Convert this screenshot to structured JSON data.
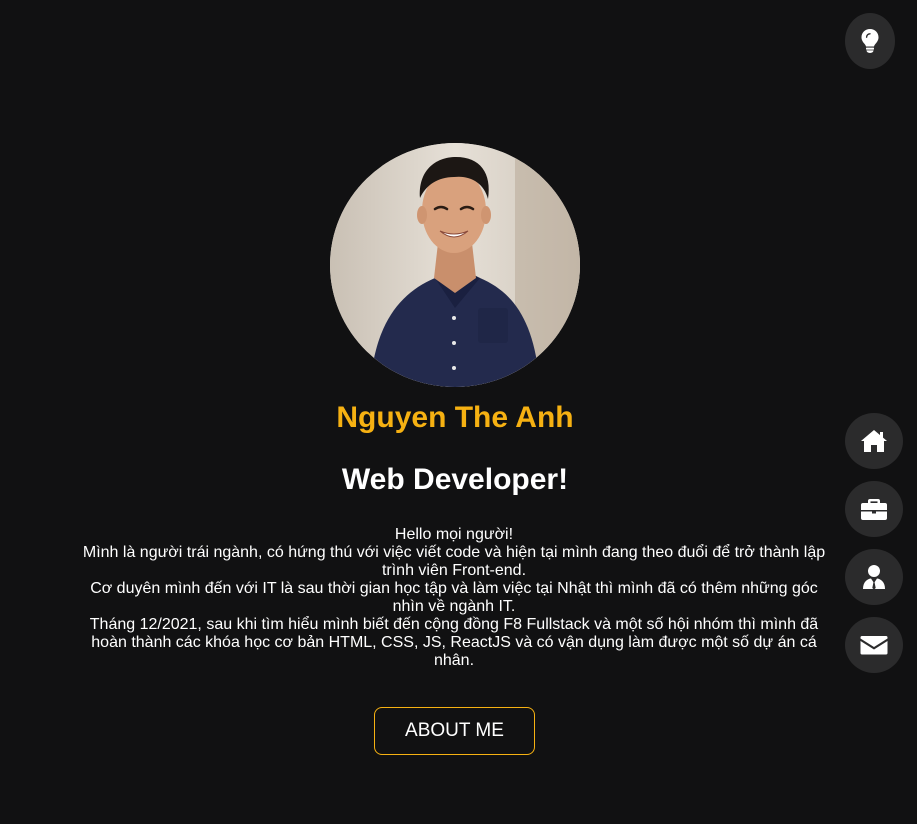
{
  "theme_toggle": {
    "icon": "lightbulb-icon"
  },
  "profile": {
    "name": "Nguyen The Anh",
    "role": "Web Developer!",
    "bio": [
      "Hello mọi người!",
      "Mình là người trái ngành, có hứng thú với việc viết code và hiện tại mình đang theo đuổi để trở thành lập trình viên Front-end.",
      "Cơ duyên mình đến với IT là sau thời gian học tập và làm việc tại Nhật thì mình đã có thêm những góc nhìn về ngành IT.",
      "Tháng 12/2021, sau khi tìm hiểu mình biết đến cộng đồng F8 Fullstack và một số hội nhóm thì mình đã hoàn thành các khóa học cơ bản HTML, CSS, JS, ReactJS và có vận dụng làm được một số dự án cá nhân."
    ],
    "about_button": "ABOUT ME"
  },
  "side_nav": [
    {
      "icon": "home-icon"
    },
    {
      "icon": "briefcase-icon"
    },
    {
      "icon": "user-tie-icon"
    },
    {
      "icon": "envelope-icon"
    }
  ],
  "colors": {
    "background": "#111112",
    "accent": "#f6b112",
    "button_bg": "#2b2b2c",
    "text": "#ffffff"
  }
}
